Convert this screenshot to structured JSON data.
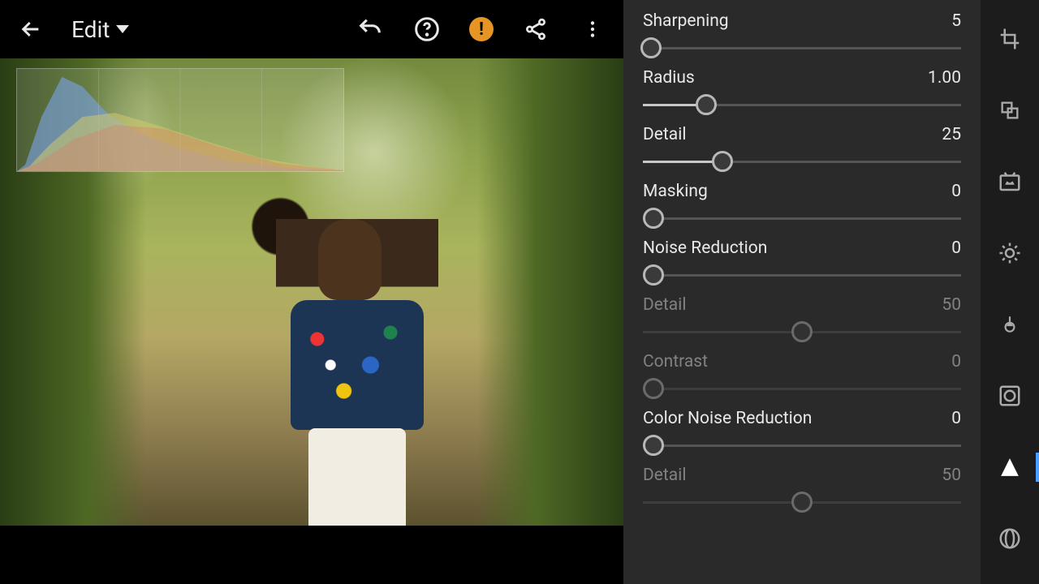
{
  "topbar": {
    "mode_label": "Edit"
  },
  "panel": {
    "sliders": [
      {
        "label": "Sharpening",
        "value": "5",
        "pos": 0.025,
        "fill": 0.025,
        "origin": "left",
        "enabled": true
      },
      {
        "label": "Radius",
        "value": "1.00",
        "pos": 0.2,
        "fill": 0.2,
        "origin": "left",
        "enabled": true
      },
      {
        "label": "Detail",
        "value": "25",
        "pos": 0.25,
        "fill": 0.25,
        "origin": "left",
        "enabled": true
      },
      {
        "label": "Masking",
        "value": "0",
        "pos": 0.0,
        "fill": 0.0,
        "origin": "left",
        "enabled": true
      },
      {
        "label": "Noise Reduction",
        "value": "0",
        "pos": 0.0,
        "fill": 0.0,
        "origin": "left",
        "enabled": true
      },
      {
        "label": "Detail",
        "value": "50",
        "pos": 0.5,
        "fill": 0.0,
        "origin": "left",
        "enabled": false
      },
      {
        "label": "Contrast",
        "value": "0",
        "pos": 0.0,
        "fill": 0.0,
        "origin": "left",
        "enabled": false
      },
      {
        "label": "Color Noise Reduction",
        "value": "0",
        "pos": 0.0,
        "fill": 0.0,
        "origin": "left",
        "enabled": true
      },
      {
        "label": "Detail",
        "value": "50",
        "pos": 0.5,
        "fill": 0.0,
        "origin": "left",
        "enabled": false
      }
    ]
  },
  "tools": [
    {
      "name": "crop",
      "active": false
    },
    {
      "name": "presets",
      "active": false
    },
    {
      "name": "auto",
      "active": false
    },
    {
      "name": "light",
      "active": false
    },
    {
      "name": "color",
      "active": false
    },
    {
      "name": "effects",
      "active": false
    },
    {
      "name": "detail",
      "active": true
    },
    {
      "name": "optics",
      "active": false
    }
  ]
}
